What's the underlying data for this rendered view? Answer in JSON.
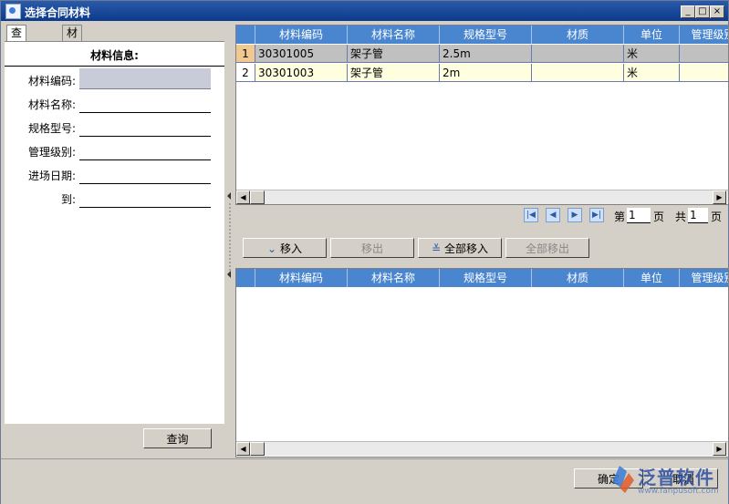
{
  "window": {
    "title": "选择合同材料",
    "min_label": "_",
    "max_label": "□",
    "close_label": "×"
  },
  "left": {
    "tabs": [
      "查询条件",
      "材料类别"
    ],
    "info_header": "材料信息:",
    "fields": [
      "材料编码:",
      "材料名称:",
      "规格型号:",
      "管理级别:",
      "进场日期:",
      "到:"
    ],
    "query_button": "查询"
  },
  "top_grid": {
    "columns": [
      "",
      "材料编码",
      "材料名称",
      "规格型号",
      "材质",
      "单位",
      "管理级别"
    ],
    "rows": [
      {
        "num": "1",
        "code": "30301005",
        "name": "架子管",
        "spec": "2.5m",
        "material": "",
        "unit": "米",
        "level": ""
      },
      {
        "num": "2",
        "code": "30301003",
        "name": "架子管",
        "spec": "2m",
        "material": "",
        "unit": "米",
        "level": ""
      }
    ]
  },
  "pager": {
    "page_prefix": "第",
    "page_value": "1",
    "page_suffix": "页",
    "total_prefix": "共",
    "total_value": "1",
    "total_suffix": "页"
  },
  "actions": {
    "move_in": "移入",
    "move_out": "移出",
    "move_all_in": "全部移入",
    "move_all_out": "全部移出"
  },
  "bottom_grid": {
    "columns": [
      "",
      "材料编码",
      "材料名称",
      "规格型号",
      "材质",
      "单位",
      "管理级别"
    ]
  },
  "footer": {
    "confirm": "确定",
    "cancel": "取消"
  },
  "watermark": {
    "brand": "泛普软件",
    "url": "www.fanpusoft.com"
  },
  "colors": {
    "title_bar": "#0c3a8c",
    "grid_header": "#4a86d0",
    "row_selected": "#c0c0c0",
    "row_highlight": "#ffffe0",
    "row_border": "#6a7ab0"
  }
}
